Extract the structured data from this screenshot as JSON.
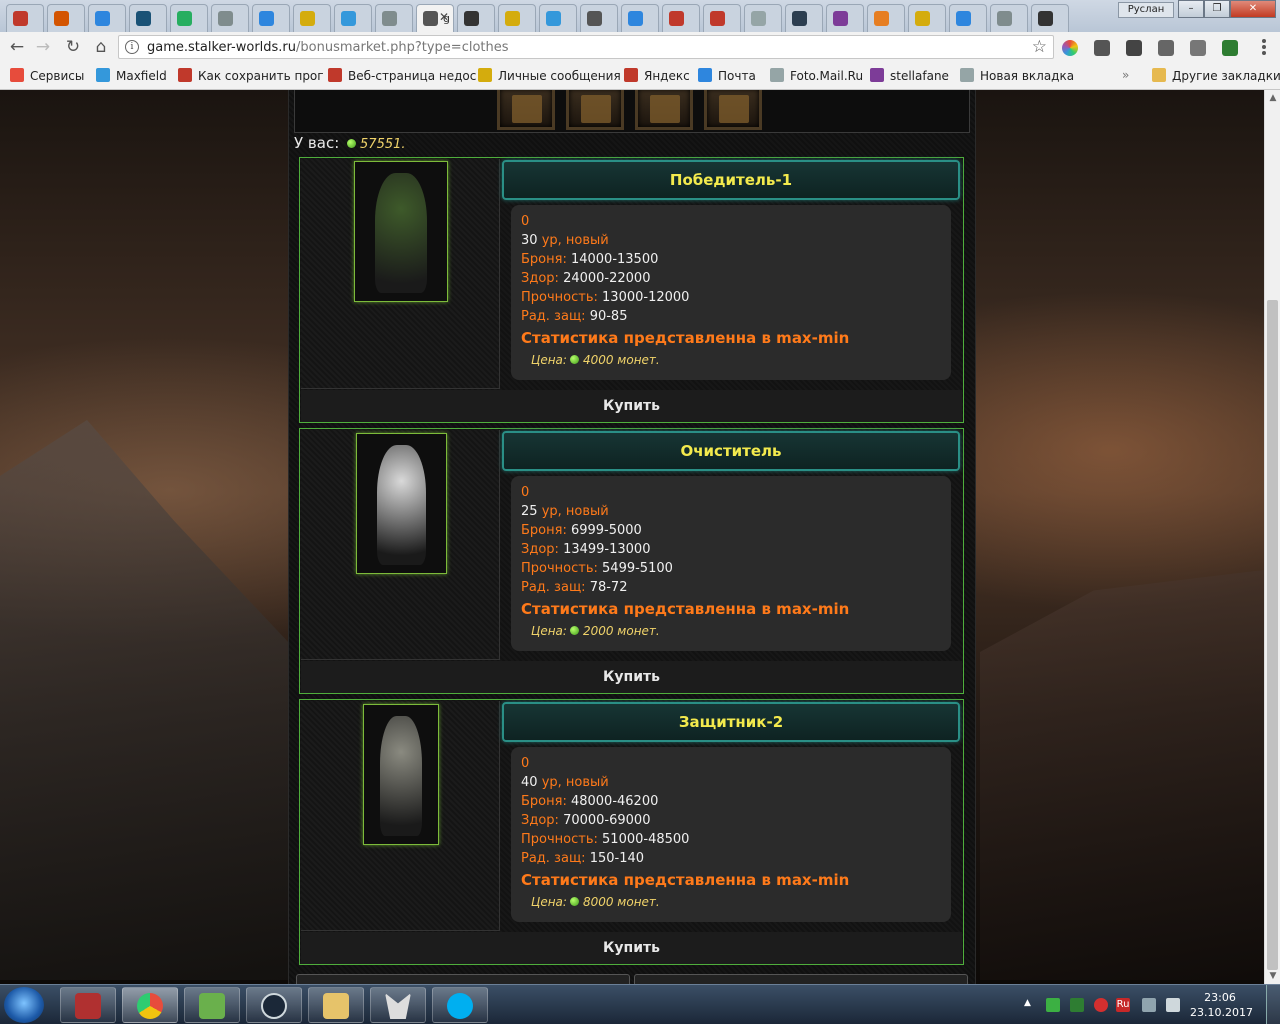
{
  "browser": {
    "tabs": [
      {
        "fav": "#c0392b"
      },
      {
        "fav": "#d35400"
      },
      {
        "fav": "#2e86de"
      },
      {
        "fav": "#1a5276"
      },
      {
        "fav": "#27ae60"
      },
      {
        "fav": "#7f8c8d"
      },
      {
        "fav": "#2e86de"
      },
      {
        "fav": "#d4ac0d"
      },
      {
        "fav": "#3498db"
      },
      {
        "fav": "#7f8c8d"
      },
      {
        "fav": "#555555",
        "label": "g",
        "active": true
      },
      {
        "fav": "#333333"
      },
      {
        "fav": "#d4ac0d"
      },
      {
        "fav": "#3498db"
      },
      {
        "fav": "#555555"
      },
      {
        "fav": "#2e86de"
      },
      {
        "fav": "#c0392b"
      },
      {
        "fav": "#c0392b"
      },
      {
        "fav": "#95a5a6"
      },
      {
        "fav": "#2c3e50"
      },
      {
        "fav": "#7d3c98"
      },
      {
        "fav": "#e67e22"
      },
      {
        "fav": "#d4ac0d"
      },
      {
        "fav": "#2e86de"
      },
      {
        "fav": "#7f8c8d"
      },
      {
        "fav": "#333333"
      }
    ],
    "user_name": "Руслан",
    "url_host": "game.stalker-worlds.ru",
    "url_path": "/bonusmarket.php?type=clothes",
    "bookmarks": [
      {
        "label": "Сервисы",
        "color": "#e74c3c"
      },
      {
        "label": "Maxfield",
        "color": "#3498db"
      },
      {
        "label": "Как сохранить прог",
        "color": "#c0392b"
      },
      {
        "label": "Веб-страница недос",
        "color": "#c0392b"
      },
      {
        "label": "Личные сообщения",
        "color": "#d4ac0d"
      },
      {
        "label": "Яндекс",
        "color": "#c0392b"
      },
      {
        "label": "Почта",
        "color": "#2e86de"
      },
      {
        "label": "Foto.Mail.Ru",
        "color": "#95a5a6"
      },
      {
        "label": "stellafane",
        "color": "#7d3c98"
      },
      {
        "label": "Новая вкладка",
        "color": "#95a5a6"
      }
    ],
    "more_bookmarks": "»",
    "other_bookmarks": "Другие закладки"
  },
  "page": {
    "balance_label": "У вас:",
    "balance_value": "57551.",
    "items": [
      {
        "name": "Победитель-1",
        "zero": "0",
        "level_value": "30",
        "level_suffix": "ур, новый",
        "armor_label": "Броня:",
        "armor_value": "14000-13500",
        "health_label": "Здор:",
        "health_value": "24000-22000",
        "durability_label": "Прочность:",
        "durability_value": "13000-12000",
        "rad_label": "Рад. защ:",
        "rad_value": "90-85",
        "note": "Статистика представленна в max-min",
        "price_label": "Цена:",
        "price_value": "4000 монет.",
        "buy_label": "Купить",
        "image_color": "#3e5a2a"
      },
      {
        "name": "Очиститель",
        "zero": "0",
        "level_value": "25",
        "level_suffix": "ур, новый",
        "armor_label": "Броня:",
        "armor_value": "6999-5000",
        "health_label": "Здор:",
        "health_value": "13499-13000",
        "durability_label": "Прочность:",
        "durability_value": "5499-5100",
        "rad_label": "Рад. защ:",
        "rad_value": "78-72",
        "note": "Статистика представленна в max-min",
        "price_label": "Цена:",
        "price_value": "2000 монет.",
        "buy_label": "Купить",
        "image_color": "#d9d9d9"
      },
      {
        "name": "Защитник-2",
        "zero": "0",
        "level_value": "40",
        "level_suffix": "ур, новый",
        "armor_label": "Броня:",
        "armor_value": "48000-46200",
        "health_label": "Здор:",
        "health_value": "70000-69000",
        "durability_label": "Прочность:",
        "durability_value": "51000-48500",
        "rad_label": "Рад. защ:",
        "rad_value": "150-140",
        "note": "Статистика представленна в max-min",
        "price_label": "Цена:",
        "price_value": "8000 монет.",
        "buy_label": "Купить",
        "image_color": "#8a8a80"
      }
    ]
  },
  "taskbar": {
    "time": "23:06",
    "date": "23.10.2017",
    "lang": "Ru"
  }
}
